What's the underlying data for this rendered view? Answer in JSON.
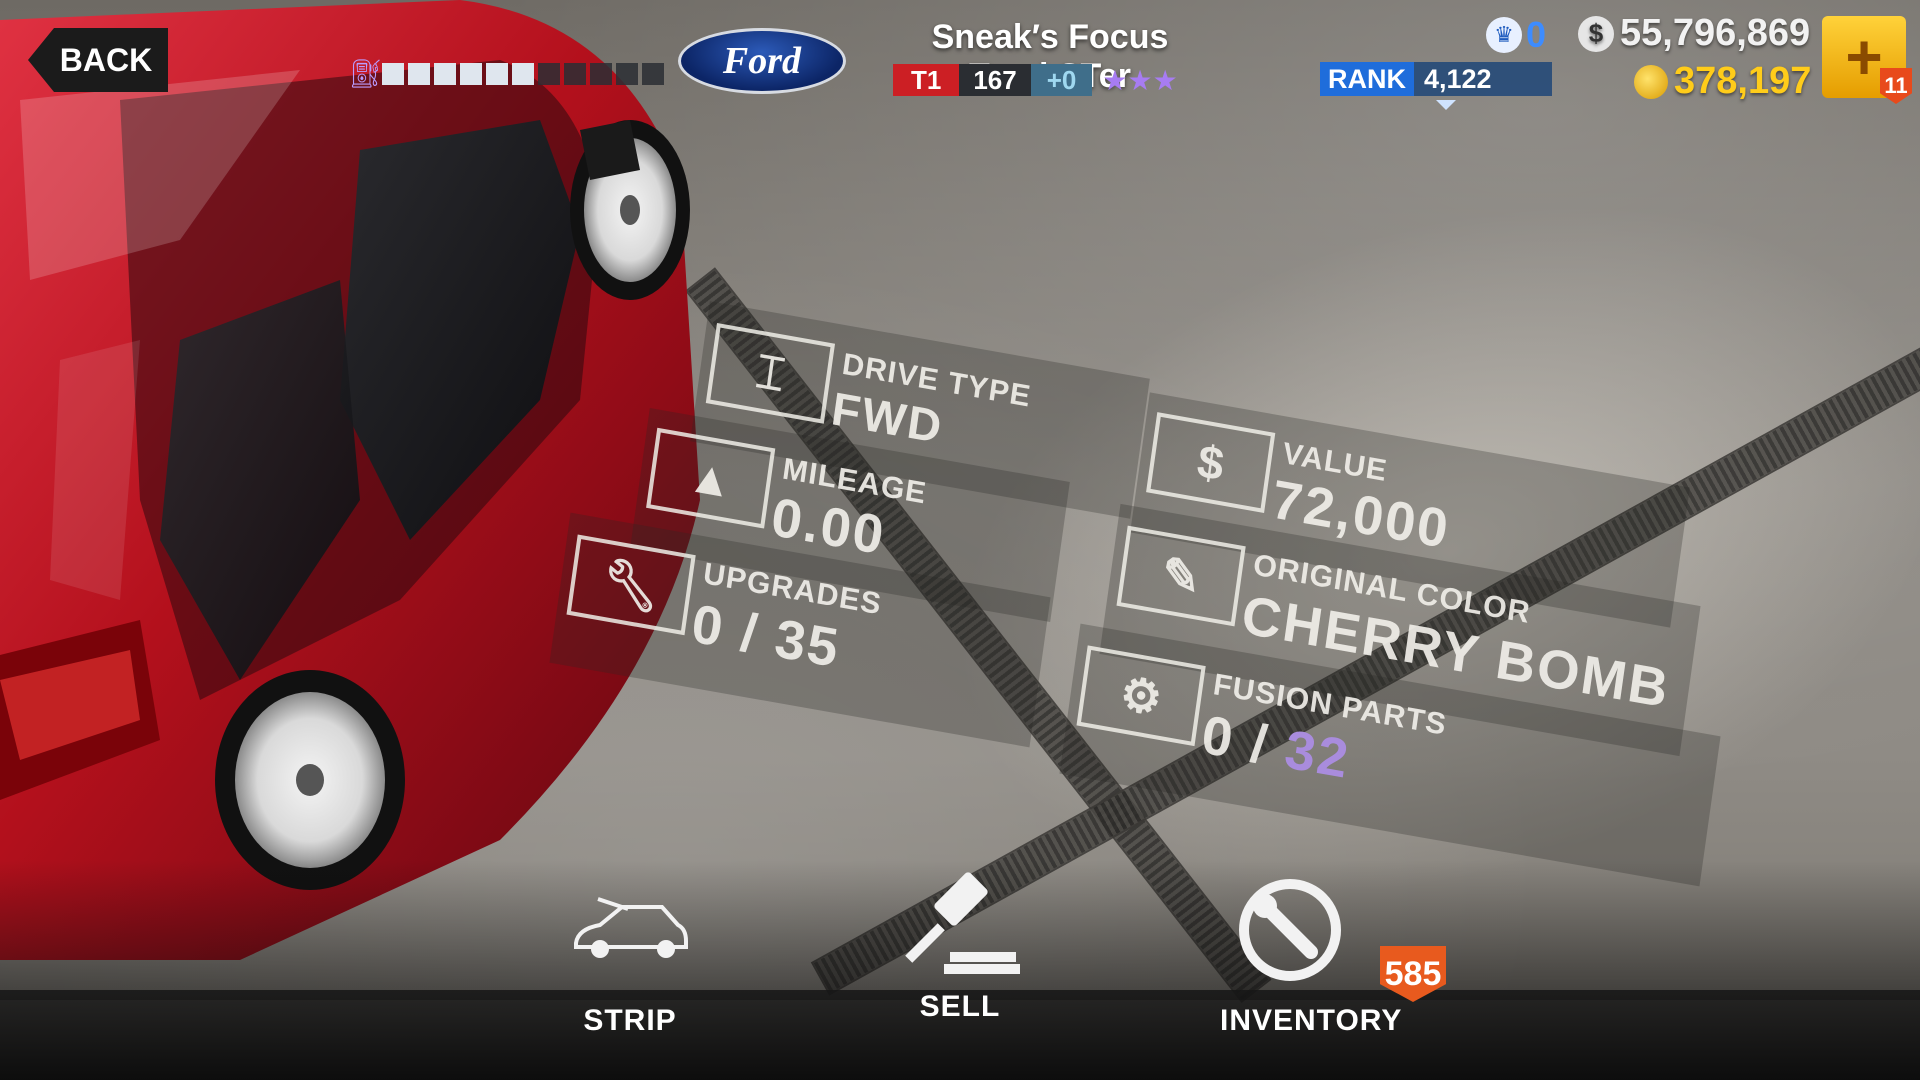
{
  "hud": {
    "back_label": "BACK",
    "brand_logo": "Ford",
    "car_name": "Sneak′s Focus TrackSTer",
    "tier": "T1",
    "performance_points": "167",
    "boost": "+0",
    "stars": "★★★",
    "rank_label": "RANK",
    "rank_value": "4,122",
    "crown_count": "0",
    "cash": "55,796,869",
    "gold": "378,197",
    "plus_badge": "11"
  },
  "stats": {
    "drive_type_label": "DRIVE TYPE",
    "drive_type_value": "FWD",
    "mileage_label": "MILEAGE",
    "mileage_value": "0.00",
    "upgrades_label": "UPGRADES",
    "upgrades_value": "0 / 35",
    "value_label": "VALUE",
    "value_value": "72,000",
    "color_label": "ORIGINAL COLOR",
    "color_value": "CHERRY BOMB",
    "fusion_label": "FUSION PARTS",
    "fusion_value_prefix": "0 /",
    "fusion_value_total": "32",
    "value_symbol": "$"
  },
  "actions": {
    "strip_label": "STRIP",
    "sell_label": "SELL",
    "inventory_label": "INVENTORY",
    "inventory_badge": "585"
  },
  "icons": [
    "fuel-icon",
    "ford-logo",
    "star-icon",
    "crown-icon",
    "cash-icon",
    "gold-icon",
    "plus-icon",
    "drivetrain-icon",
    "road-icon",
    "wrench-icon",
    "dollar-icon",
    "spray-gun-icon",
    "fusion-icon",
    "car-strip-icon",
    "gavel-icon",
    "inventory-wrench-icon"
  ],
  "colors": {
    "tier_red": "#cc1f24",
    "rank_blue": "#1f6ddb",
    "gold_yellow": "#ffcc1a",
    "fusion_purple": "#a98cdd",
    "badge_orange": "#e85a1e",
    "car_red": "#b3101c"
  },
  "fuel": {
    "filled": 6,
    "total": 11
  }
}
